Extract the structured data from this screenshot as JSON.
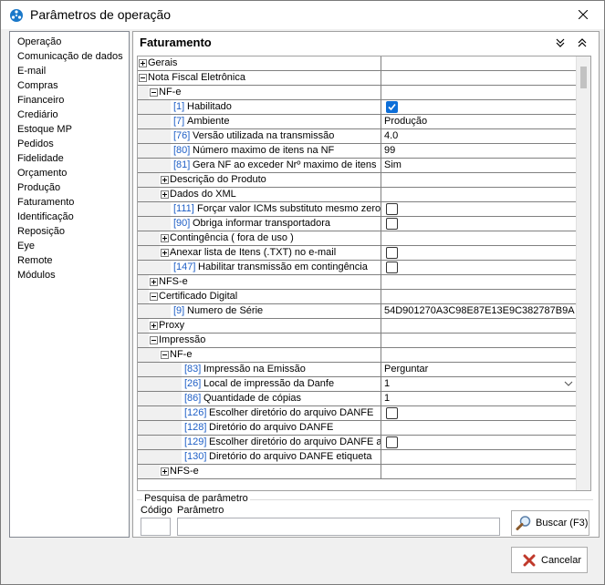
{
  "window": {
    "title": "Parâmetros de operação"
  },
  "sidebar": {
    "items": [
      "Operação",
      "Comunicação de dados",
      "E-mail",
      "Compras",
      "Financeiro",
      "Crediário",
      "Estoque MP",
      "Pedidos",
      "Fidelidade",
      "Orçamento",
      "Produção",
      "Faturamento",
      "Identificação",
      "Reposição",
      "Eye",
      "Remote",
      "Módulos"
    ]
  },
  "main": {
    "title": "Faturamento"
  },
  "grid": {
    "rows": [
      {
        "level": 0,
        "toggle": "plus",
        "code": "",
        "label": "Gerais",
        "value": ""
      },
      {
        "level": 0,
        "toggle": "minus",
        "code": "",
        "label": "Nota Fiscal Eletrônica",
        "value": ""
      },
      {
        "level": 1,
        "toggle": "minus",
        "code": "",
        "label": "NF-e",
        "value": ""
      },
      {
        "level": 2,
        "toggle": "",
        "code": "[1]",
        "label": "Habilitado",
        "value": "",
        "check": "on"
      },
      {
        "level": 2,
        "toggle": "",
        "code": "[7]",
        "label": "Ambiente",
        "value": "Produção"
      },
      {
        "level": 2,
        "toggle": "",
        "code": "[76]",
        "label": "Versão utilizada na transmissão",
        "value": "4.0"
      },
      {
        "level": 2,
        "toggle": "",
        "code": "[80]",
        "label": "Número maximo de itens na NF",
        "value": "99"
      },
      {
        "level": 2,
        "toggle": "",
        "code": "[81]",
        "label": "Gera NF ao exceder Nrº maximo de itens",
        "value": "Sim"
      },
      {
        "level": 2,
        "toggle": "plus",
        "code": "",
        "label": "Descrição do Produto",
        "value": ""
      },
      {
        "level": 2,
        "toggle": "plus",
        "code": "",
        "label": "Dados do XML",
        "value": ""
      },
      {
        "level": 2,
        "toggle": "",
        "code": "[111]",
        "label": "Forçar valor ICMs substituto mesmo zero",
        "value": "",
        "check": "off"
      },
      {
        "level": 2,
        "toggle": "",
        "code": "[90]",
        "label": "Obriga informar transportadora",
        "value": "",
        "check": "off"
      },
      {
        "level": 2,
        "toggle": "plus",
        "code": "",
        "label": "Contingência ( fora de uso )",
        "value": ""
      },
      {
        "level": 2,
        "toggle": "plus",
        "code": "",
        "label": "Anexar lista de Itens (.TXT) no e-mail",
        "value": "",
        "check": "off"
      },
      {
        "level": 2,
        "toggle": "",
        "code": "[147]",
        "label": "Habilitar transmissão em contingência",
        "value": "",
        "check": "off"
      },
      {
        "level": 1,
        "toggle": "plus",
        "code": "",
        "label": "NFS-e",
        "value": ""
      },
      {
        "level": 1,
        "toggle": "minus",
        "code": "",
        "label": "Certificado Digital",
        "value": ""
      },
      {
        "level": 2,
        "toggle": "",
        "code": "[9]",
        "label": "Numero de Série",
        "value": "54D901270A3C98E87E13E9C382787B9A"
      },
      {
        "level": 1,
        "toggle": "plus",
        "code": "",
        "label": "Proxy",
        "value": ""
      },
      {
        "level": 1,
        "toggle": "minus",
        "code": "",
        "label": "Impressão",
        "value": ""
      },
      {
        "level": 2,
        "toggle": "minus",
        "code": "",
        "label": "NF-e",
        "value": ""
      },
      {
        "level": 3,
        "toggle": "",
        "code": "[83]",
        "label": "Impressão na Emissão",
        "value": "Perguntar"
      },
      {
        "level": 3,
        "toggle": "",
        "code": "[26]",
        "label": "Local de impressão da Danfe",
        "value": "1",
        "dropdown": true
      },
      {
        "level": 3,
        "toggle": "",
        "code": "[86]",
        "label": "Quantidade de cópias",
        "value": "1"
      },
      {
        "level": 3,
        "toggle": "",
        "code": "[126]",
        "label": "Escolher diretório do arquivo DANFE",
        "value": "",
        "check": "off"
      },
      {
        "level": 3,
        "toggle": "",
        "code": "[128]",
        "label": "Diretório do arquivo DANFE",
        "value": ""
      },
      {
        "level": 3,
        "toggle": "",
        "code": "[129]",
        "label": "Escolher diretório do arquivo DANFE  a",
        "value": "",
        "check": "off"
      },
      {
        "level": 3,
        "toggle": "",
        "code": "[130]",
        "label": "Diretório do arquivo DANFE etiqueta",
        "value": ""
      },
      {
        "level": 2,
        "toggle": "plus",
        "code": "",
        "label": "NFS-e",
        "value": ""
      }
    ]
  },
  "search": {
    "group_title": "Pesquisa de parâmetro",
    "codigo_label": "Código",
    "parametro_label": "Parâmetro",
    "codigo_value": "",
    "parametro_value": "",
    "button_label": "Buscar (F3)"
  },
  "footer": {
    "cancel_label": "Cancelar"
  },
  "colors": {
    "code_text": "#1f5fc6",
    "checkbox_on": "#0c6ed8",
    "cancel_icon": "#c0392b"
  }
}
